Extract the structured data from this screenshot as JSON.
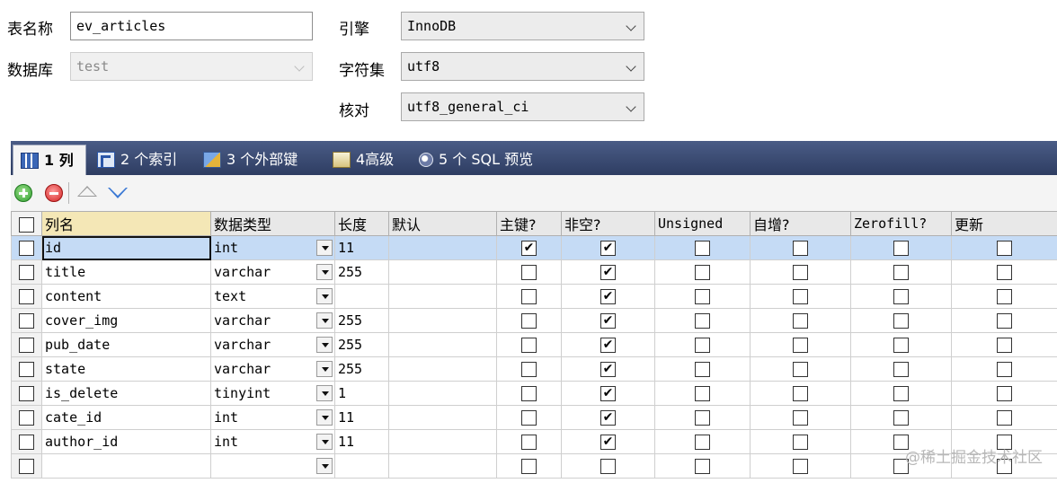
{
  "form": {
    "table_name_label": "表名称",
    "table_name_value": "ev_articles",
    "database_label": "数据库",
    "database_value": "test",
    "engine_label": "引擎",
    "engine_value": "InnoDB",
    "charset_label": "字符集",
    "charset_value": "utf8",
    "collation_label": "核对",
    "collation_value": "utf8_general_ci"
  },
  "tabs": [
    {
      "label": "1 列",
      "icon": "columns-icon",
      "active": true
    },
    {
      "label": "2 个索引",
      "icon": "index-icon",
      "active": false
    },
    {
      "label": "3 个外部键",
      "icon": "foreign-key-icon",
      "active": false
    },
    {
      "label": "4高级",
      "icon": "advanced-icon",
      "active": false
    },
    {
      "label": "5 个 SQL 预览",
      "icon": "sql-preview-icon",
      "active": false
    }
  ],
  "toolbar": {
    "icons": [
      "add-icon",
      "remove-icon",
      "move-up-icon",
      "move-down-icon"
    ]
  },
  "columns_header": {
    "name": "列名",
    "type": "数据类型",
    "length": "长度",
    "default": "默认",
    "primary": "主键?",
    "not_null": "非空?",
    "unsigned": "Unsigned",
    "auto_inc": "自增?",
    "zerofill": "Zerofill?",
    "update": "更新"
  },
  "rows": [
    {
      "name": "id",
      "type": "int",
      "length": "11",
      "default": "",
      "primary": "✔",
      "not_null": "✔",
      "unsigned": "",
      "auto_inc": "",
      "zerofill": "",
      "update": ""
    },
    {
      "name": "title",
      "type": "varchar",
      "length": "255",
      "default": "",
      "primary": "",
      "not_null": "✔",
      "unsigned": "",
      "auto_inc": "",
      "zerofill": "",
      "update": ""
    },
    {
      "name": "content",
      "type": "text",
      "length": "",
      "default": "",
      "primary": "",
      "not_null": "✔",
      "unsigned": "",
      "auto_inc": "",
      "zerofill": "",
      "update": ""
    },
    {
      "name": "cover_img",
      "type": "varchar",
      "length": "255",
      "default": "",
      "primary": "",
      "not_null": "✔",
      "unsigned": "",
      "auto_inc": "",
      "zerofill": "",
      "update": ""
    },
    {
      "name": "pub_date",
      "type": "varchar",
      "length": "255",
      "default": "",
      "primary": "",
      "not_null": "✔",
      "unsigned": "",
      "auto_inc": "",
      "zerofill": "",
      "update": ""
    },
    {
      "name": "state",
      "type": "varchar",
      "length": "255",
      "default": "",
      "primary": "",
      "not_null": "✔",
      "unsigned": "",
      "auto_inc": "",
      "zerofill": "",
      "update": ""
    },
    {
      "name": "is_delete",
      "type": "tinyint",
      "length": "1",
      "default": "",
      "primary": "",
      "not_null": "✔",
      "unsigned": "",
      "auto_inc": "",
      "zerofill": "",
      "update": ""
    },
    {
      "name": "cate_id",
      "type": "int",
      "length": "11",
      "default": "",
      "primary": "",
      "not_null": "✔",
      "unsigned": "",
      "auto_inc": "",
      "zerofill": "",
      "update": ""
    },
    {
      "name": "author_id",
      "type": "int",
      "length": "11",
      "default": "",
      "primary": "",
      "not_null": "✔",
      "unsigned": "",
      "auto_inc": "",
      "zerofill": "",
      "update": ""
    },
    {
      "name": "",
      "type": "",
      "length": "",
      "default": "",
      "primary": "",
      "not_null": "",
      "unsigned": "",
      "auto_inc": "",
      "zerofill": "",
      "update": ""
    }
  ],
  "watermark": "@稀土掘金技术社区"
}
